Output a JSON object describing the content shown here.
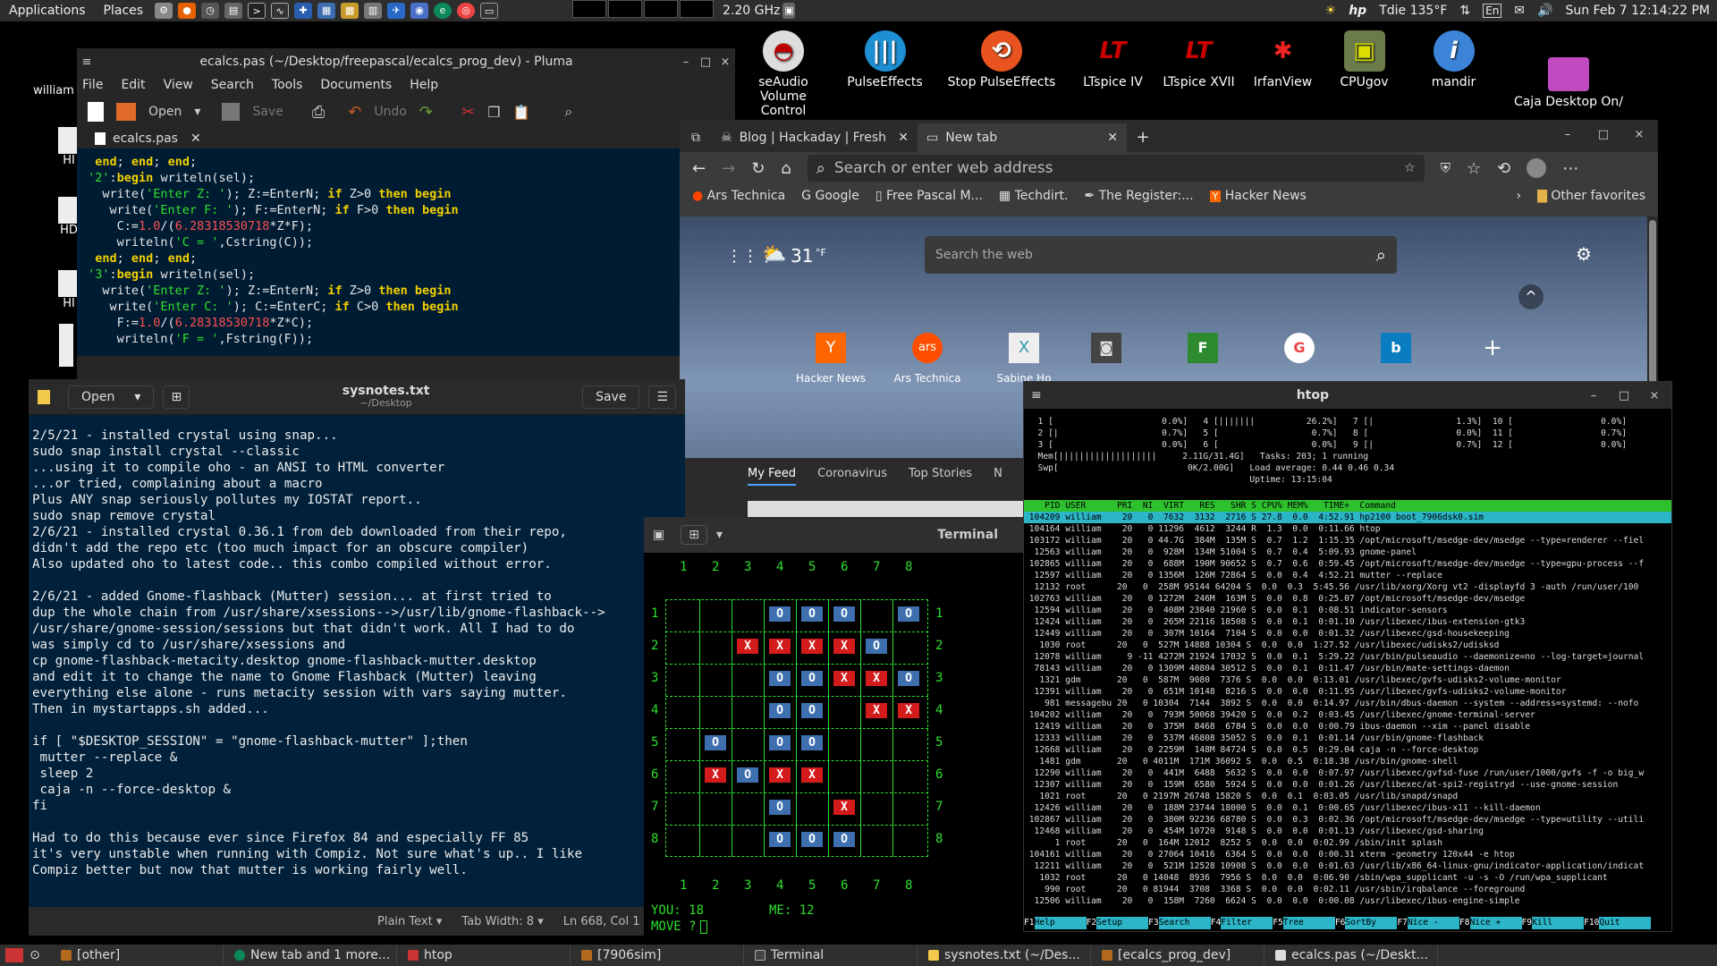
{
  "topbar": {
    "applications": "Applications",
    "places": "Places",
    "cpu": "2.20 GHz",
    "temp": "Tdie 135°F",
    "lang": "En",
    "clock": "Sun Feb 7 12:14:22 PM"
  },
  "desktop_icons": [
    {
      "label": "seAudio Volume Control"
    },
    {
      "label": "PulseEffects"
    },
    {
      "label": "Stop PulseEffects"
    },
    {
      "label": "LTspice IV"
    },
    {
      "label": "LTspice XVII"
    },
    {
      "label": "IrfanView"
    },
    {
      "label": "CPUgov"
    },
    {
      "label": "mandir"
    },
    {
      "label": "Caja Desktop On/"
    }
  ],
  "left_icons": [
    "william",
    "HI",
    "HD",
    "HI"
  ],
  "pluma": {
    "title": "ecalcs.pas (~/Desktop/freepascal/ecalcs_prog_dev) - Pluma",
    "menu": [
      "File",
      "Edit",
      "View",
      "Search",
      "Tools",
      "Documents",
      "Help"
    ],
    "open": "Open",
    "save": "Save",
    "undo": "Undo",
    "tab": "ecalcs.pas"
  },
  "pluma_code": [
    "  end; end; end;",
    " '2':begin writeln(sel);",
    "   write('Enter Z: '); Z:=EnterN; if Z>0 then begin",
    "    write('Enter F: '); F:=EnterN; if F>0 then begin",
    "     C:=1.0/(6.28318530718*Z*F);",
    "     writeln('C = ',Cstring(C));",
    "  end; end; end;",
    " '3':begin writeln(sel);",
    "   write('Enter Z: '); Z:=EnterN; if Z>0 then begin",
    "    write('Enter C: '); C:=EnterC; if C>0 then begin",
    "     F:=1.0/(6.28318530718*Z*C);",
    "     writeln('F = ',Fstring(F));"
  ],
  "gedit": {
    "open": "Open",
    "title": "sysnotes.txt",
    "subtitle": "~/Desktop",
    "save": "Save",
    "status_plain": "Plain Text",
    "status_tab": "Tab Width: 8",
    "status_ln": "Ln 668, Col 1"
  },
  "sysnotes": [
    "2/5/21 - installed crystal using snap...",
    "sudo snap install crystal --classic",
    "...using it to compile oho - an ANSI to HTML converter",
    "...or tried, complaining about a macro",
    "Plus ANY snap seriously pollutes my IOSTAT report..",
    "sudo snap remove crystal",
    "2/6/21 - installed crystal 0.36.1 from deb downloaded from their repo,",
    "didn't add the repo etc (too much impact for an obscure compiler)",
    "Also updated oho to latest code.. this combo compiled without error.",
    "",
    "2/6/21 - added Gnome-flashback (Mutter) session... at first tried to",
    "dup the whole chain from /usr/share/xsessions-->/usr/lib/gnome-flashback-->",
    "/usr/share/gnome-session/sessions but that didn't work. All I had to do",
    "was simply cd to /usr/share/xsessions and",
    "cp gnome-flashback-metacity.desktop gnome-flashback-mutter.desktop",
    "and edit it to change the name to Gnome Flashback (Mutter) leaving",
    "everything else alone - runs metacity session with vars saying mutter.",
    "Then in mystartapps.sh added...",
    "",
    "if [ \"$DESKTOP_SESSION\" = \"gnome-flashback-mutter\" ];then",
    " mutter --replace &",
    " sleep 2",
    " caja -n --force-desktop &",
    "fi",
    "",
    "Had to do this because ever since Firefox 84 and especially FF 85",
    "it's very unstable when running with Compiz. Not sure what's up.. I like",
    "Compiz better but now that mutter is working fairly well."
  ],
  "edge": {
    "tab1": "Blog | Hackaday | Fresh H",
    "tab2": "New tab",
    "address_placeholder": "Search or enter web address",
    "favorites": [
      "Ars Technica",
      "Google",
      "Free Pascal M...",
      "Techdirt.",
      "The Register:...",
      "Hacker News"
    ],
    "other_favorites": "Other favorites",
    "temp": "31",
    "temp_unit": "°F",
    "search_placeholder": "Search the web",
    "tiles": [
      "Hacker News",
      "Ars Technica",
      "Sabine Ho"
    ],
    "feed_tabs": [
      "My Feed",
      "Coronavirus",
      "Top Stories",
      "N"
    ]
  },
  "terminal": {
    "title": "Terminal",
    "cols": "1   2   3   4   5   6   7   8",
    "you": "YOU: 18",
    "me": "ME: 12",
    "move": "MOVE ?"
  },
  "board": [
    [
      "",
      "",
      "",
      "O",
      "O",
      "O",
      "",
      "O"
    ],
    [
      "",
      "",
      "X",
      "X",
      "X",
      "X",
      "O",
      ""
    ],
    [
      "",
      "",
      "",
      "O",
      "O",
      "X",
      "X",
      "O"
    ],
    [
      "",
      "",
      "",
      "O",
      "O",
      "",
      "X",
      "X"
    ],
    [
      "",
      "O",
      "",
      "O",
      "O",
      "",
      "",
      ""
    ],
    [
      "",
      "X",
      "O",
      "X",
      "X",
      "",
      "",
      ""
    ],
    [
      "",
      "",
      "",
      "O",
      "",
      "X",
      "",
      ""
    ],
    [
      "",
      "",
      "",
      "O",
      "O",
      "O",
      "",
      ""
    ]
  ],
  "htop": {
    "title": "htop",
    "meters": [
      "  1 [                     0.0%]   4 [|||||||          26.2%]   7 [|                1.3%]  10 [                 0.0%]",
      "  2 [|                    0.7%]   5 [                  0.7%]   8 [                 0.0%]  11 [                 0.7%]",
      "  3 [                     0.0%]   6 [                  0.0%]   9 [|                0.7%]  12 [                 0.0%]",
      "  Mem[|||||||||||||||||||     2.11G/31.4G]   Tasks: 203; 1 running",
      "  Swp[                         0K/2.00G]   Load average: 0.44 0.46 0.34",
      "                                           Uptime: 13:15:04"
    ],
    "header": "    PID USER      PRI  NI  VIRT   RES   SHR S CPU% MEM%   TIME+  Command",
    "selected": " 104209 william    20   0  7632  3132  2716 S 27.8  0.0  4:52.91 hp2100 boot_7906dsk0.sim",
    "rows": [
      " 104164 william    20   0 11296  4612  3244 R  1.3  0.0  0:11.66 htop",
      " 103172 william    20   0 44.7G  384M  135M S  0.7  1.2  1:15.35 /opt/microsoft/msedge-dev/msedge --type=renderer --fiel",
      "  12563 william    20   0  928M  134M 51004 S  0.7  0.4  5:09.93 gnome-panel",
      " 102865 william    20   0  688M  190M 90652 S  0.7  0.6  0:59.45 /opt/microsoft/msedge-dev/msedge --type=gpu-process --f",
      "  12597 william    20   0 1356M  126M 72864 S  0.0  0.4  4:52.21 mutter --replace",
      "  12132 root      20   0  258M 95144 64204 S  0.0  0.3  5:45.56 /usr/lib/xorg/Xorg vt2 -displayfd 3 -auth /run/user/100",
      " 102763 william    20   0 1272M  246M  163M S  0.0  0.8  0:25.07 /opt/microsoft/msedge-dev/msedge",
      "  12594 william    20   0  408M 23840 21960 S  0.0  0.1  0:08.51 indicator-sensors",
      "  12424 william    20   0  265M 22116 18508 S  0.0  0.1  0:01.10 /usr/libexec/ibus-extension-gtk3",
      "  12449 william    20   0  307M 10164  7104 S  0.0  0.0  0:01.32 /usr/libexec/gsd-housekeeping",
      "   1030 root      20   0  527M 14888 10304 S  0.0  0.0  1:27.52 /usr/libexec/udisks2/udisksd",
      "  12078 william     9 -11 4272M 21924 17032 S  0.0  0.1  5:29.22 /usr/bin/pulseaudio --daemonize=no --log-target=journal",
      "  78143 william    20   0 1309M 40804 30512 S  0.0  0.1  0:11.47 /usr/bin/mate-settings-daemon",
      "   1321 gdm       20   0  587M  9080  7376 S  0.0  0.0  0:13.01 /usr/libexec/gvfs-udisks2-volume-monitor",
      "  12391 william    20   0  651M 10148  8216 S  0.0  0.0  0:11.95 /usr/libexec/gvfs-udisks2-volume-monitor",
      "    981 messagebu 20   0 10304  7144  3892 S  0.0  0.0  0:14.97 /usr/bin/dbus-daemon --system --address=systemd: --nofo",
      " 104202 william    20   0  793M 50068 39420 S  0.0  0.2  0:03.45 /usr/libexec/gnome-terminal-server",
      "  12419 william    20   0  375M  8468  6784 S  0.0  0.0  0:00.79 ibus-daemon --xim --panel disable",
      "  12333 william    20   0  537M 46808 35052 S  0.0  0.1  0:01.14 /usr/bin/gnome-flashback",
      "  12668 william    20   0 2259M  148M 84724 S  0.0  0.5  0:29.04 caja -n --force-desktop",
      "   1481 gdm       20   0 4011M  171M 36092 S  0.0  0.5  0:18.38 /usr/bin/gnome-shell",
      "  12290 william    20   0  441M  6488  5632 S  0.0  0.0  0:07.97 /usr/libexec/gvfsd-fuse /run/user/1000/gvfs -f -o big_w",
      "  12307 william    20   0  159M  6580  5924 S  0.0  0.0  0:01.26 /usr/libexec/at-spi2-registryd --use-gnome-session",
      "   1021 root      20   0 2197M 26748 15820 S  0.0  0.1  0:03.05 /usr/lib/snapd/snapd",
      "  12426 william    20   0  188M 23744 18000 S  0.0  0.1  0:00.65 /usr/libexec/ibus-x11 --kill-daemon",
      " 102867 william    20   0  380M 92236 68780 S  0.0  0.3  0:02.36 /opt/microsoft/msedge-dev/msedge --type=utility --utili",
      "  12468 william    20   0  454M 10720  9148 S  0.0  0.0  0:01.13 /usr/libexec/gsd-sharing",
      "      1 root      20   0  164M 12012  8252 S  0.0  0.0  0:02.99 /sbin/init splash",
      " 104161 william    20   0 27064 10416  6364 S  0.0  0.0  0:00.31 xterm -geometry 120x44 -e htop",
      "  12211 william    20   0  521M 12528 10908 S  0.0  0.0  0:01.63 /usr/lib/x86_64-linux-gnu/indicator-application/indicat",
      "   1032 root      20   0 14048  8936  7956 S  0.0  0.0  0:06.90 /sbin/wpa_supplicant -u -s -O /run/wpa_supplicant",
      "    990 root      20   0 81944  3708  3368 S  0.0  0.0  0:02.11 /usr/sbin/irqbalance --foreground",
      "  12506 william    20   0  158M  7260  6624 S  0.0  0.0  0:00.08 /usr/libexec/ibus-engine-simple"
    ],
    "fkeys": [
      [
        "F1",
        "Help"
      ],
      [
        "F2",
        "Setup"
      ],
      [
        "F3",
        "Search"
      ],
      [
        "F4",
        "Filter"
      ],
      [
        "F5",
        "Tree"
      ],
      [
        "F6",
        "SortBy"
      ],
      [
        "F7",
        "Nice -"
      ],
      [
        "F8",
        "Nice +"
      ],
      [
        "F9",
        "Kill"
      ],
      [
        "F10",
        "Quit"
      ]
    ]
  },
  "taskbar": [
    "[other]",
    "New tab and 1 more...",
    "htop",
    "[7906sim]",
    "Terminal",
    "sysnotes.txt (~/Des...",
    "[ecalcs_prog_dev]",
    "ecalcs.pas (~/Deskt..."
  ]
}
